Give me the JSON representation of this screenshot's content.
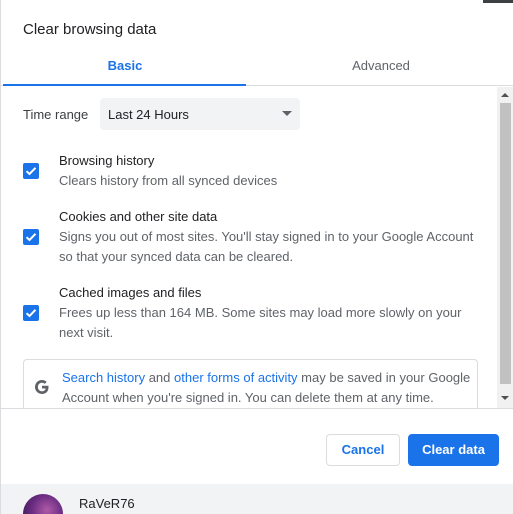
{
  "dialog": {
    "title": "Clear browsing data"
  },
  "tabs": [
    {
      "label": "Basic",
      "selected": true
    },
    {
      "label": "Advanced",
      "selected": false
    }
  ],
  "time_range": {
    "label": "Time range",
    "value": "Last 24 Hours"
  },
  "items": [
    {
      "title": "Browsing history",
      "description": "Clears history from all synced devices",
      "checked": true
    },
    {
      "title": "Cookies and other site data",
      "description": "Signs you out of most sites. You'll stay signed in to your Google Account so that your synced data can be cleared.",
      "checked": true
    },
    {
      "title": "Cached images and files",
      "description": "Frees up less than 164 MB. Some sites may load more slowly on your next visit.",
      "checked": true
    }
  ],
  "info": {
    "link1": "Search history",
    "connector": " and ",
    "link2": "other forms of activity",
    "rest": " may be saved in your Google Account when you're signed in. You can delete them at any time."
  },
  "buttons": {
    "cancel": "Cancel",
    "clear": "Clear data"
  },
  "account": {
    "username": "RaVeR76"
  },
  "colors": {
    "accent": "#1a73e8"
  }
}
